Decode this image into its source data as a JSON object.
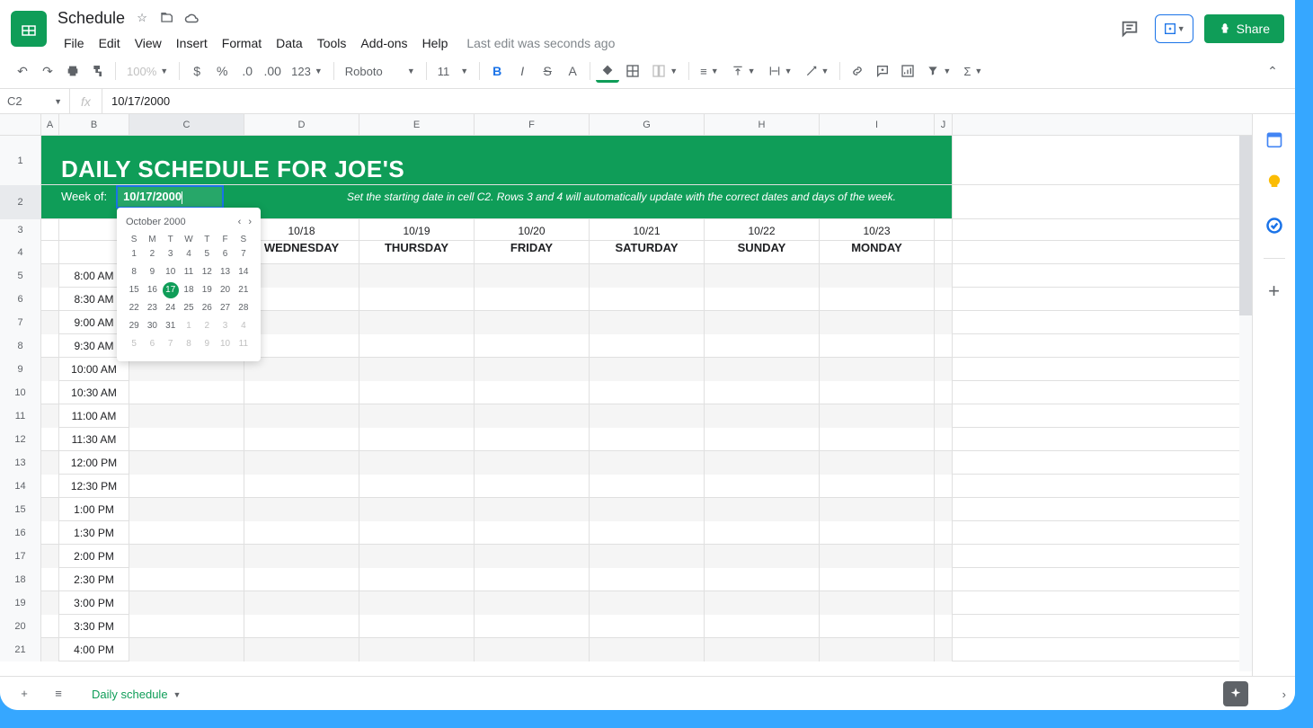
{
  "doc": {
    "title": "Schedule",
    "last_edit": "Last edit was seconds ago"
  },
  "menus": [
    "File",
    "Edit",
    "View",
    "Insert",
    "Format",
    "Data",
    "Tools",
    "Add-ons",
    "Help"
  ],
  "share": {
    "label": "Share"
  },
  "toolbar": {
    "zoom": "100%",
    "font": "Roboto",
    "size": "11",
    "format_num": "123"
  },
  "formula_bar": {
    "cell": "C2",
    "value": "10/17/2000"
  },
  "columns": [
    "A",
    "B",
    "C",
    "D",
    "E",
    "F",
    "G",
    "H",
    "I",
    "J"
  ],
  "col_widths": {
    "A": 20,
    "B": 78,
    "C": 128,
    "D": 128,
    "E": 128,
    "F": 128,
    "G": 128,
    "H": 128,
    "I": 128,
    "J": 20
  },
  "selected_col": "C",
  "selected_row": 2,
  "banner": {
    "title": "DAILY SCHEDULE FOR JOE'S",
    "week_label": "Week of:",
    "date_value": "10/17/2000",
    "hint": "Set the starting date in cell C2. Rows 3 and 4 will automatically update with the correct dates and days of the week."
  },
  "day_columns": [
    {
      "date": "10/18",
      "day": "WEDNESDAY"
    },
    {
      "date": "10/19",
      "day": "THURSDAY"
    },
    {
      "date": "10/20",
      "day": "FRIDAY"
    },
    {
      "date": "10/21",
      "day": "SATURDAY"
    },
    {
      "date": "10/22",
      "day": "SUNDAY"
    },
    {
      "date": "10/23",
      "day": "MONDAY"
    }
  ],
  "times": [
    "8:00 AM",
    "8:30 AM",
    "9:00 AM",
    "9:30 AM",
    "10:00 AM",
    "10:30 AM",
    "11:00 AM",
    "11:30 AM",
    "12:00 PM",
    "12:30 PM",
    "1:00 PM",
    "1:30 PM",
    "2:00 PM",
    "2:30 PM",
    "3:00 PM",
    "3:30 PM",
    "4:00 PM"
  ],
  "datepicker": {
    "month_label": "October 2000",
    "dows": [
      "S",
      "M",
      "T",
      "W",
      "T",
      "F",
      "S"
    ],
    "weeks": [
      [
        {
          "d": "1"
        },
        {
          "d": "2"
        },
        {
          "d": "3"
        },
        {
          "d": "4"
        },
        {
          "d": "5"
        },
        {
          "d": "6"
        },
        {
          "d": "7"
        }
      ],
      [
        {
          "d": "8"
        },
        {
          "d": "9"
        },
        {
          "d": "10"
        },
        {
          "d": "11"
        },
        {
          "d": "12"
        },
        {
          "d": "13"
        },
        {
          "d": "14"
        }
      ],
      [
        {
          "d": "15"
        },
        {
          "d": "16"
        },
        {
          "d": "17",
          "sel": true
        },
        {
          "d": "18"
        },
        {
          "d": "19"
        },
        {
          "d": "20"
        },
        {
          "d": "21"
        }
      ],
      [
        {
          "d": "22"
        },
        {
          "d": "23"
        },
        {
          "d": "24"
        },
        {
          "d": "25"
        },
        {
          "d": "26"
        },
        {
          "d": "27"
        },
        {
          "d": "28"
        }
      ],
      [
        {
          "d": "29"
        },
        {
          "d": "30"
        },
        {
          "d": "31"
        },
        {
          "d": "1",
          "m": true
        },
        {
          "d": "2",
          "m": true
        },
        {
          "d": "3",
          "m": true
        },
        {
          "d": "4",
          "m": true
        }
      ],
      [
        {
          "d": "5",
          "m": true
        },
        {
          "d": "6",
          "m": true
        },
        {
          "d": "7",
          "m": true
        },
        {
          "d": "8",
          "m": true
        },
        {
          "d": "9",
          "m": true
        },
        {
          "d": "10",
          "m": true
        },
        {
          "d": "11",
          "m": true
        }
      ]
    ]
  },
  "sheet_tab": {
    "name": "Daily schedule"
  }
}
